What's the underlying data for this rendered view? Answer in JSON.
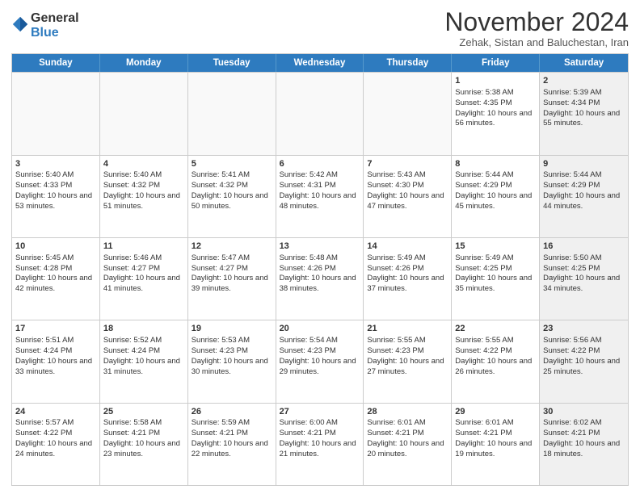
{
  "logo": {
    "general": "General",
    "blue": "Blue"
  },
  "header": {
    "month": "November 2024",
    "location": "Zehak, Sistan and Baluchestan, Iran"
  },
  "weekdays": [
    "Sunday",
    "Monday",
    "Tuesday",
    "Wednesday",
    "Thursday",
    "Friday",
    "Saturday"
  ],
  "rows": [
    [
      {
        "day": "",
        "info": "",
        "shaded": false,
        "empty": true
      },
      {
        "day": "",
        "info": "",
        "shaded": false,
        "empty": true
      },
      {
        "day": "",
        "info": "",
        "shaded": false,
        "empty": true
      },
      {
        "day": "",
        "info": "",
        "shaded": false,
        "empty": true
      },
      {
        "day": "",
        "info": "",
        "shaded": false,
        "empty": true
      },
      {
        "day": "1",
        "info": "Sunrise: 5:38 AM\nSunset: 4:35 PM\nDaylight: 10 hours and 56 minutes.",
        "shaded": false,
        "empty": false
      },
      {
        "day": "2",
        "info": "Sunrise: 5:39 AM\nSunset: 4:34 PM\nDaylight: 10 hours and 55 minutes.",
        "shaded": true,
        "empty": false
      }
    ],
    [
      {
        "day": "3",
        "info": "Sunrise: 5:40 AM\nSunset: 4:33 PM\nDaylight: 10 hours and 53 minutes.",
        "shaded": false,
        "empty": false
      },
      {
        "day": "4",
        "info": "Sunrise: 5:40 AM\nSunset: 4:32 PM\nDaylight: 10 hours and 51 minutes.",
        "shaded": false,
        "empty": false
      },
      {
        "day": "5",
        "info": "Sunrise: 5:41 AM\nSunset: 4:32 PM\nDaylight: 10 hours and 50 minutes.",
        "shaded": false,
        "empty": false
      },
      {
        "day": "6",
        "info": "Sunrise: 5:42 AM\nSunset: 4:31 PM\nDaylight: 10 hours and 48 minutes.",
        "shaded": false,
        "empty": false
      },
      {
        "day": "7",
        "info": "Sunrise: 5:43 AM\nSunset: 4:30 PM\nDaylight: 10 hours and 47 minutes.",
        "shaded": false,
        "empty": false
      },
      {
        "day": "8",
        "info": "Sunrise: 5:44 AM\nSunset: 4:29 PM\nDaylight: 10 hours and 45 minutes.",
        "shaded": false,
        "empty": false
      },
      {
        "day": "9",
        "info": "Sunrise: 5:44 AM\nSunset: 4:29 PM\nDaylight: 10 hours and 44 minutes.",
        "shaded": true,
        "empty": false
      }
    ],
    [
      {
        "day": "10",
        "info": "Sunrise: 5:45 AM\nSunset: 4:28 PM\nDaylight: 10 hours and 42 minutes.",
        "shaded": false,
        "empty": false
      },
      {
        "day": "11",
        "info": "Sunrise: 5:46 AM\nSunset: 4:27 PM\nDaylight: 10 hours and 41 minutes.",
        "shaded": false,
        "empty": false
      },
      {
        "day": "12",
        "info": "Sunrise: 5:47 AM\nSunset: 4:27 PM\nDaylight: 10 hours and 39 minutes.",
        "shaded": false,
        "empty": false
      },
      {
        "day": "13",
        "info": "Sunrise: 5:48 AM\nSunset: 4:26 PM\nDaylight: 10 hours and 38 minutes.",
        "shaded": false,
        "empty": false
      },
      {
        "day": "14",
        "info": "Sunrise: 5:49 AM\nSunset: 4:26 PM\nDaylight: 10 hours and 37 minutes.",
        "shaded": false,
        "empty": false
      },
      {
        "day": "15",
        "info": "Sunrise: 5:49 AM\nSunset: 4:25 PM\nDaylight: 10 hours and 35 minutes.",
        "shaded": false,
        "empty": false
      },
      {
        "day": "16",
        "info": "Sunrise: 5:50 AM\nSunset: 4:25 PM\nDaylight: 10 hours and 34 minutes.",
        "shaded": true,
        "empty": false
      }
    ],
    [
      {
        "day": "17",
        "info": "Sunrise: 5:51 AM\nSunset: 4:24 PM\nDaylight: 10 hours and 33 minutes.",
        "shaded": false,
        "empty": false
      },
      {
        "day": "18",
        "info": "Sunrise: 5:52 AM\nSunset: 4:24 PM\nDaylight: 10 hours and 31 minutes.",
        "shaded": false,
        "empty": false
      },
      {
        "day": "19",
        "info": "Sunrise: 5:53 AM\nSunset: 4:23 PM\nDaylight: 10 hours and 30 minutes.",
        "shaded": false,
        "empty": false
      },
      {
        "day": "20",
        "info": "Sunrise: 5:54 AM\nSunset: 4:23 PM\nDaylight: 10 hours and 29 minutes.",
        "shaded": false,
        "empty": false
      },
      {
        "day": "21",
        "info": "Sunrise: 5:55 AM\nSunset: 4:23 PM\nDaylight: 10 hours and 27 minutes.",
        "shaded": false,
        "empty": false
      },
      {
        "day": "22",
        "info": "Sunrise: 5:55 AM\nSunset: 4:22 PM\nDaylight: 10 hours and 26 minutes.",
        "shaded": false,
        "empty": false
      },
      {
        "day": "23",
        "info": "Sunrise: 5:56 AM\nSunset: 4:22 PM\nDaylight: 10 hours and 25 minutes.",
        "shaded": true,
        "empty": false
      }
    ],
    [
      {
        "day": "24",
        "info": "Sunrise: 5:57 AM\nSunset: 4:22 PM\nDaylight: 10 hours and 24 minutes.",
        "shaded": false,
        "empty": false
      },
      {
        "day": "25",
        "info": "Sunrise: 5:58 AM\nSunset: 4:21 PM\nDaylight: 10 hours and 23 minutes.",
        "shaded": false,
        "empty": false
      },
      {
        "day": "26",
        "info": "Sunrise: 5:59 AM\nSunset: 4:21 PM\nDaylight: 10 hours and 22 minutes.",
        "shaded": false,
        "empty": false
      },
      {
        "day": "27",
        "info": "Sunrise: 6:00 AM\nSunset: 4:21 PM\nDaylight: 10 hours and 21 minutes.",
        "shaded": false,
        "empty": false
      },
      {
        "day": "28",
        "info": "Sunrise: 6:01 AM\nSunset: 4:21 PM\nDaylight: 10 hours and 20 minutes.",
        "shaded": false,
        "empty": false
      },
      {
        "day": "29",
        "info": "Sunrise: 6:01 AM\nSunset: 4:21 PM\nDaylight: 10 hours and 19 minutes.",
        "shaded": false,
        "empty": false
      },
      {
        "day": "30",
        "info": "Sunrise: 6:02 AM\nSunset: 4:21 PM\nDaylight: 10 hours and 18 minutes.",
        "shaded": true,
        "empty": false
      }
    ]
  ]
}
